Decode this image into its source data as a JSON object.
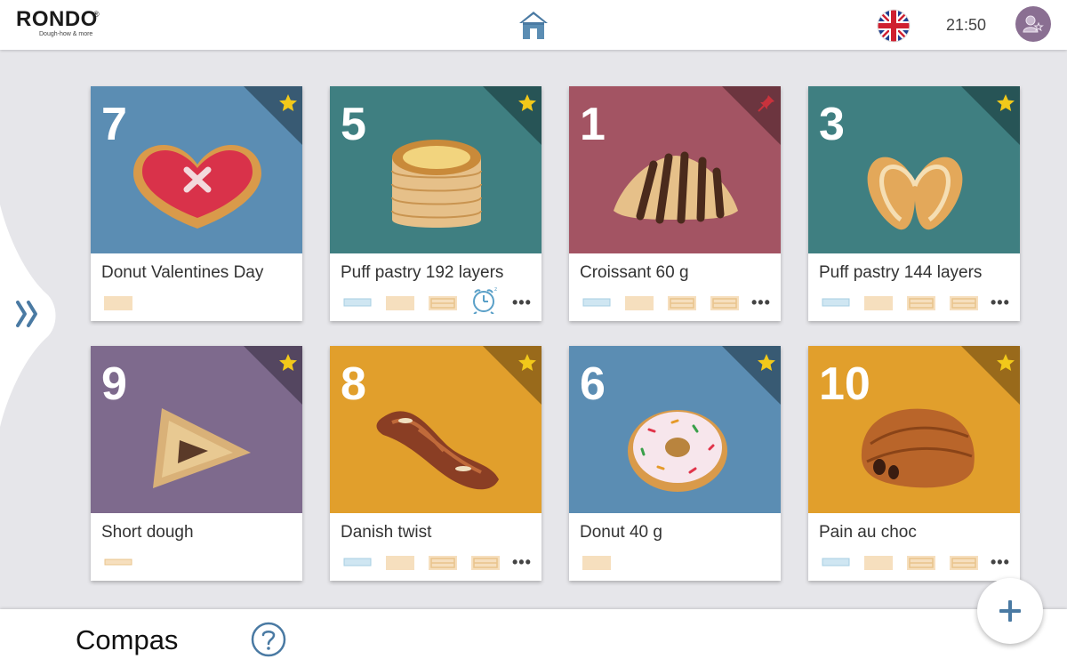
{
  "header": {
    "logo_text": "RONDO",
    "logo_reg": "®",
    "logo_tagline": "Dough-how & more",
    "time": "21:50"
  },
  "footer": {
    "title": "Compas"
  },
  "colors": {
    "blue": "#5b8db3",
    "teal": "#3f7f81",
    "rose": "#a35463",
    "purple": "#7e6a8d",
    "orange": "#e19f2c",
    "star": "#f2c91a",
    "pin": "#c8323c",
    "tray_blue": "#cfe6f2",
    "tray_beige": "#f6dfbe"
  },
  "cards": [
    {
      "number": "7",
      "name": "Donut Valentines Day",
      "bg": "#5b8db3",
      "badge": "star-icon",
      "product_icon": "heart-donut-icon",
      "trays": [
        "beige"
      ],
      "extra": ""
    },
    {
      "number": "5",
      "name": "Puff pastry 192 layers",
      "bg": "#3f7f81",
      "badge": "star-icon",
      "product_icon": "vol-au-vent-icon",
      "trays": [
        "blue",
        "beige",
        "beige-lines",
        "alarm"
      ],
      "extra": "more"
    },
    {
      "number": "1",
      "name": "Croissant 60 g",
      "bg": "#a35463",
      "badge": "pin-icon",
      "product_icon": "croissant-icon",
      "trays": [
        "blue",
        "beige",
        "beige-lines",
        "beige-lines"
      ],
      "extra": "more"
    },
    {
      "number": "3",
      "name": "Puff pastry 144 layers",
      "bg": "#3f7f81",
      "badge": "star-icon",
      "product_icon": "palmier-icon",
      "trays": [
        "blue",
        "beige",
        "beige-lines",
        "beige-lines"
      ],
      "extra": "more"
    },
    {
      "number": "9",
      "name": "Short dough",
      "bg": "#7e6a8d",
      "badge": "star-icon",
      "product_icon": "hamantasch-icon",
      "trays": [
        "beige-thin"
      ],
      "extra": ""
    },
    {
      "number": "8",
      "name": "Danish twist",
      "bg": "#e19f2c",
      "badge": "star-icon",
      "product_icon": "danish-twist-icon",
      "trays": [
        "blue",
        "beige",
        "beige-lines",
        "beige-lines"
      ],
      "extra": "more"
    },
    {
      "number": "6",
      "name": "Donut 40 g",
      "bg": "#5b8db3",
      "badge": "star-icon",
      "product_icon": "donut-icon",
      "trays": [
        "beige"
      ],
      "extra": ""
    },
    {
      "number": "10",
      "name": "Pain au choc",
      "bg": "#e19f2c",
      "badge": "star-icon",
      "product_icon": "pain-au-chocolat-icon",
      "trays": [
        "blue",
        "beige",
        "beige-lines",
        "beige-lines"
      ],
      "extra": "more"
    }
  ]
}
